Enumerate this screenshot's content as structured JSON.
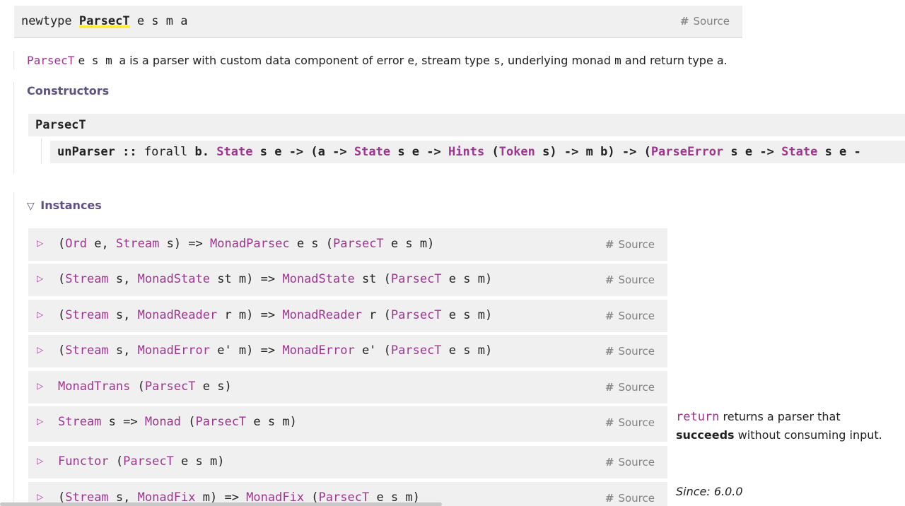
{
  "header": {
    "keyword": "newtype",
    "name": "ParsecT",
    "params": "e s m a",
    "source_hash": "#",
    "source_label": "Source"
  },
  "description": {
    "type_name": "ParsecT",
    "type_params": "e s m a",
    "text_1": "is a parser with custom data component of error",
    "var_e": "e",
    "text_2": ", stream type",
    "var_s": "s",
    "text_3": ", underlying monad",
    "var_m": "m",
    "text_4": "and return type",
    "var_a": "a",
    "text_5": "."
  },
  "constructors": {
    "title": "Constructors",
    "name": "ParsecT",
    "field": {
      "name": "unParser",
      "sep": "::",
      "forall": "forall",
      "b": "b.",
      "State": "State",
      "se": "s e",
      "arrow": "->",
      "open_a": "(a",
      "Hints": "Hints",
      "Token": "Token",
      "s_close": "s)",
      "mb": "m b)",
      "open_paren": "(",
      "ParseError": "ParseError",
      "State2": "State",
      "se2": "s e",
      "trail": "-"
    }
  },
  "instances": {
    "toggle_icon": "▽",
    "title": "Instances",
    "row_arrow": "▷",
    "source_hash": "#",
    "source_label": "Source",
    "rows": [
      {
        "p1": "(",
        "c1": "Ord",
        "p2": " e, ",
        "c2": "Stream",
        "p3": " s) => ",
        "c3": "MonadParsec",
        "p4": " e s (",
        "c4": "ParsecT",
        "p5": " e s m)"
      },
      {
        "p1": "(",
        "c1": "Stream",
        "p2": " s, ",
        "c2": "MonadState",
        "p3": " st m) => ",
        "c3": "MonadState",
        "p4": " st (",
        "c4": "ParsecT",
        "p5": " e s m)"
      },
      {
        "p1": "(",
        "c1": "Stream",
        "p2": " s, ",
        "c2": "MonadReader",
        "p3": " r m) => ",
        "c3": "MonadReader",
        "p4": " r (",
        "c4": "ParsecT",
        "p5": " e s m)"
      },
      {
        "p1": "(",
        "c1": "Stream",
        "p2": " s, ",
        "c2": "MonadError",
        "p3": " e' m) => ",
        "c3": "MonadError",
        "p4": " e' (",
        "c4": "ParsecT",
        "p5": " e s m)"
      },
      {
        "c1": "MonadTrans",
        "p2": " (",
        "c2": "ParsecT",
        "p3": " e s)"
      },
      {
        "c1": "Stream",
        "p2": " s => ",
        "c2": "Monad",
        "p3": " (",
        "c3": "ParsecT",
        "p4": " e s m)"
      },
      {
        "c1": "Functor",
        "p2": " (",
        "c2": "ParsecT",
        "p3": " e s m)"
      },
      {
        "p1": "(",
        "c1": "Stream",
        "p2": " s, ",
        "c2": "MonadFix",
        "p3": " m) => ",
        "c3": "MonadFix",
        "p4": " (",
        "c4": "ParsecT",
        "p5": " e s m)"
      }
    ]
  },
  "monad_doc": {
    "code": "return",
    "text_1": "returns a parser that",
    "bold": "succeeds",
    "text_2": "without consuming input.",
    "since": "Since: 6.0.0"
  }
}
